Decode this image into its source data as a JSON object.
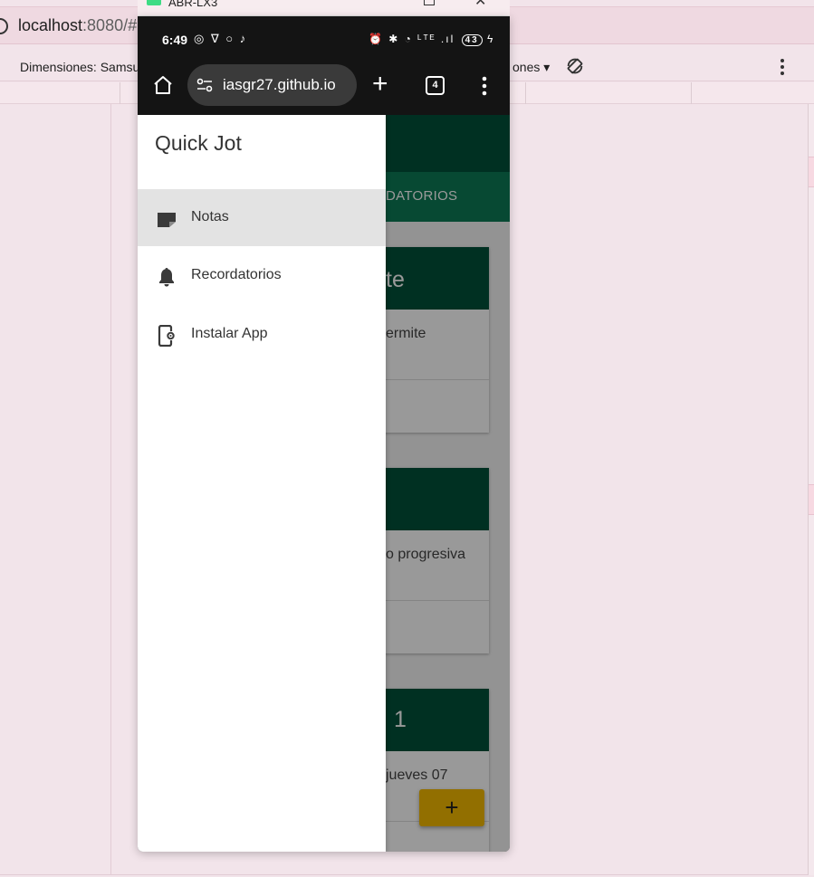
{
  "desktop": {
    "url_host": "localhost",
    "url_path": ":8080/#",
    "toolbar_left": "Dimensiones: Samsu",
    "toolbar_right": "ones ▾"
  },
  "emulator": {
    "title": "ABR-LX3"
  },
  "status_bar": {
    "time": "6:49",
    "left_icons": "◎ ∇ ○ ♪",
    "system_icons": "⏰ ✱ ◔ ᴸᵀᴱ .ıl",
    "battery": "43"
  },
  "chrome": {
    "url": "iasgr27.github.io",
    "tab_count": "4"
  },
  "app": {
    "tab_partial": "DATORIOS",
    "cards": [
      {
        "head": "te",
        "body": "ermite"
      },
      {
        "head": "",
        "body": "o progresiva"
      },
      {
        "head": "1",
        "body": "jueves 07"
      }
    ],
    "fab_label": "+"
  },
  "drawer": {
    "title": "Quick Jot",
    "items": [
      {
        "label": "Notas",
        "icon": "note-icon",
        "active": true
      },
      {
        "label": "Recordatorios",
        "icon": "bell-icon",
        "active": false
      },
      {
        "label": "Instalar App",
        "icon": "install-app-icon",
        "active": false
      }
    ]
  },
  "colors": {
    "app_bar": "#00503a",
    "tab_bar": "#0d7a55",
    "fab": "#f3b900",
    "drawer_active": "#e3e3e3"
  }
}
